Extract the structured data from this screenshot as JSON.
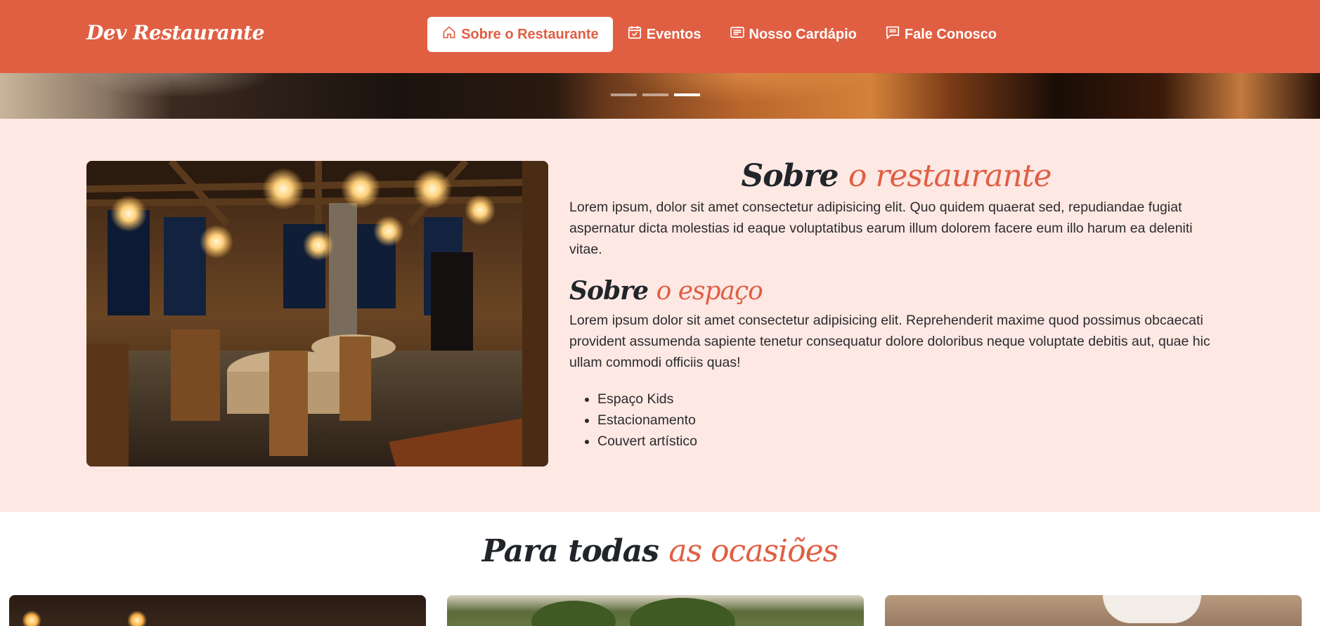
{
  "navbar": {
    "brand": "Dev Restaurante",
    "links": [
      {
        "label": "Sobre o Restaurante",
        "icon": "home-icon",
        "active": true
      },
      {
        "label": "Eventos",
        "icon": "calendar-check-icon",
        "active": false
      },
      {
        "label": "Nosso Cardápio",
        "icon": "card-text-icon",
        "active": false
      },
      {
        "label": "Fale Conosco",
        "icon": "chat-text-icon",
        "active": false
      }
    ]
  },
  "carousel": {
    "slide_count": 3,
    "active_index": 2
  },
  "about": {
    "title_main": "Sobre",
    "title_accent": "o restaurante",
    "paragraph": "Lorem ipsum, dolor sit amet consectetur adipisicing elit. Quo quidem quaerat sed, repudiandae fugiat aspernatur dicta molestias id eaque voluptatibus earum illum dolorem facere eum illo harum ea deleniti vitae.",
    "space_title_main": "Sobre",
    "space_title_accent": "o espaço",
    "space_paragraph": "Lorem ipsum dolor sit amet consectetur adipisicing elit. Reprehenderit maxime quod possimus obcaecati provident assumenda sapiente tenetur consequatur dolore doloribus neque voluptate debitis aut, quae hic ullam commodi officiis quas!",
    "features": [
      "Espaço Kids",
      "Estacionamento",
      "Couvert artístico"
    ]
  },
  "occasions": {
    "title_main": "Para todas",
    "title_accent": "as ocasiões"
  },
  "colors": {
    "primary": "#e05f43",
    "section_bg": "#fde8e4",
    "text_dark": "#212529",
    "white": "#ffffff"
  }
}
